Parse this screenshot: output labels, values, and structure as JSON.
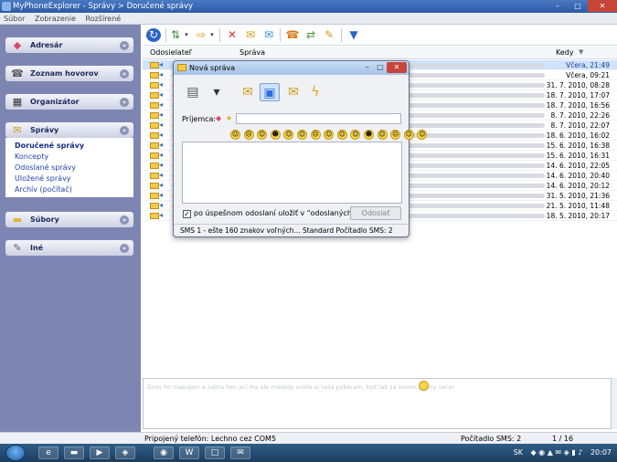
{
  "window": {
    "title": "MyPhoneExplorer  -  Správy > Doručené správy",
    "minimize": "–",
    "maximize": "□",
    "close": "✕"
  },
  "menu": [
    "Súbor",
    "Zobrazenie",
    "Rozšírené"
  ],
  "sidebar": {
    "sections": [
      {
        "label": "Adresár",
        "icon": "contacts-icon",
        "glyph": "◆"
      },
      {
        "label": "Zoznam hovorov",
        "icon": "call-list-icon",
        "glyph": "☎"
      },
      {
        "label": "Organizátor",
        "icon": "organizer-icon",
        "glyph": "▦"
      },
      {
        "label": "Správy",
        "icon": "messages-icon",
        "glyph": "✉"
      },
      {
        "label": "Súbory",
        "icon": "folder-icon",
        "glyph": "▬"
      },
      {
        "label": "Iné",
        "icon": "tools-icon",
        "glyph": "✎"
      }
    ],
    "message_folders": [
      "Doručené správy",
      "Koncepty",
      "Odoslané správy",
      "Uložené správy",
      "Archív (počítač)"
    ],
    "collapse_glyph": "»",
    "expand_glyph": "«"
  },
  "toolbar": {
    "icons": [
      "refresh-icon",
      "sync-icon",
      "dropdown-arrow-icon",
      "export-icon",
      "dropdown-arrow-icon",
      "delete-icon",
      "reply-icon",
      "forward-icon",
      "call-icon",
      "exchange-icon",
      "chat-icon",
      "filter-icon"
    ]
  },
  "list": {
    "columns": [
      "Odosielateľ",
      "Správa",
      "Kedy"
    ],
    "dates": [
      "Včera, 21:49",
      "Včera, 09:21",
      "31. 7. 2010, 08:28",
      "18. 7. 2010, 17:07",
      "18. 7. 2010, 16:56",
      "8. 7. 2010, 22:26",
      "8. 7. 2010, 22:07",
      "18. 6. 2010, 16:02",
      "15. 6. 2010, 16:38",
      "15. 6. 2010, 16:31",
      "14. 6. 2010, 22:05",
      "14. 6. 2010, 20:40",
      "14. 6. 2010, 20:12",
      "31. 5. 2010, 21:36",
      "21. 5. 2010, 11:48",
      "18. 5. 2010, 20:17"
    ]
  },
  "statusbar": {
    "phone": "Pripojený telefón: Lechno cez COM5",
    "sms_counter": "Počítadlo SMS: 2",
    "page": "1 / 16"
  },
  "taskbar": {
    "lang": "SK",
    "time": "20:07"
  },
  "dialog": {
    "title": "Nová správa",
    "recipients_label": "Príjemca:",
    "save_checkbox": "po úspešnom odoslaní uložiť v \"odoslaných\"",
    "send_button": "Odoslať",
    "status": "SMS 1 - ešte 160 znakov voľných...  Standard  Počítadlo SMS: 2",
    "toolbar_icons": [
      "print-icon",
      "save-icon",
      "open-icon",
      "template-icon",
      "attach-icon",
      "flash-sms-icon"
    ],
    "emoticons": [
      "☺",
      "☹",
      "☺",
      "☻",
      "☺",
      "☺",
      "☹",
      "☺",
      "☺",
      "☺",
      "☻",
      "☺",
      "☹",
      "☺",
      "☺"
    ]
  },
  "colors": {
    "sidebar": "#7d86b2",
    "accent": "#2c5aa6",
    "selected_row": "#cfe3fc"
  }
}
